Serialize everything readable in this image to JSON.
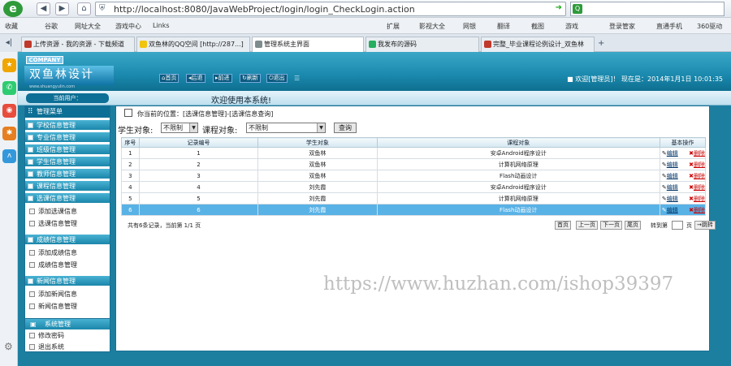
{
  "browser": {
    "url": "http://localhost:8080/JavaWebProject/login/login_CheckLogin.action",
    "favorites": [
      "收藏",
      "谷歌",
      "网址大全",
      "游戏中心",
      "Links"
    ],
    "right_tools": [
      "扩展",
      "影视大全",
      "网银",
      "翻译",
      "截图",
      "游戏",
      "登录管家",
      "直通手机",
      "360驱动"
    ],
    "tabs": [
      {
        "label": "上传资源 - 我的资源 - 下载频道",
        "color": "#c0392b"
      },
      {
        "label": "双鱼林的QQ空间 [http://287...]",
        "color": "#f1c40f"
      },
      {
        "label": "管理系统主界面",
        "color": "#7f8c8d"
      },
      {
        "label": "我发布的源码",
        "color": "#27ae60"
      },
      {
        "label": "完整_毕业课程论例设计_双鱼林",
        "color": "#c0392b"
      }
    ]
  },
  "header": {
    "company": "COMPANY",
    "brand": "双鱼林设计",
    "brand_url": "www.shuangyulin.com",
    "nav": [
      "首页",
      "后退",
      "前进",
      "刷新",
      "退出"
    ],
    "user_info": "欢迎[管理员]！  现在是：2014年1月1日  10:01:35"
  },
  "welcome": "欢迎使用本系统!",
  "current_user": "当前用户：",
  "menu": {
    "main_title": "管理菜单",
    "sections": [
      {
        "title": "学校信息管理",
        "items": []
      },
      {
        "title": "专业信息管理",
        "items": []
      },
      {
        "title": "班级信息管理",
        "items": []
      },
      {
        "title": "学生信息管理",
        "items": []
      },
      {
        "title": "教师信息管理",
        "items": []
      },
      {
        "title": "课程信息管理",
        "items": []
      },
      {
        "title": "选课信息管理",
        "items": [
          "添加选课信息",
          "选课信息管理"
        ]
      },
      {
        "title": "成绩信息管理",
        "items": [
          "添加成绩信息",
          "成绩信息管理"
        ]
      },
      {
        "title": "新闻信息管理",
        "items": [
          "添加新闻信息",
          "新闻信息管理"
        ]
      }
    ],
    "system": {
      "title": "系统管理",
      "items": [
        "修改密码",
        "退出系统"
      ]
    }
  },
  "content": {
    "position": "你当前的位置：[选课信息管理]-[选课信息查询]",
    "filter": {
      "student_label": "学生对象:",
      "student_value": "不限制",
      "course_label": "课程对象:",
      "course_value": "不限制",
      "query_button": "查询"
    },
    "table": {
      "headers": [
        "序号",
        "记录编号",
        "学生对象",
        "课程对象",
        "基本操作"
      ],
      "edit_label": "编辑",
      "delete_label": "删除",
      "rows": [
        [
          "1",
          "1",
          "双鱼林",
          "安卓Android程序设计"
        ],
        [
          "2",
          "2",
          "双鱼林",
          "计算机网络原理"
        ],
        [
          "3",
          "3",
          "双鱼林",
          "Flash动画设计"
        ],
        [
          "4",
          "4",
          "刘先霞",
          "安卓Android程序设计"
        ],
        [
          "5",
          "5",
          "刘先霞",
          "计算机网络原理"
        ],
        [
          "6",
          "6",
          "刘先霞",
          "Flash动画设计"
        ]
      ],
      "selected_row": 5
    },
    "pager": {
      "summary": "共有6条记录，当前第 1/1 页",
      "buttons": [
        "首页",
        "上一页",
        "下一页",
        "尾页"
      ],
      "goto_label": "转到第",
      "page_unit": "页",
      "go_button": "跳转"
    }
  },
  "watermark": "https://www.huzhan.com/ishop39397"
}
